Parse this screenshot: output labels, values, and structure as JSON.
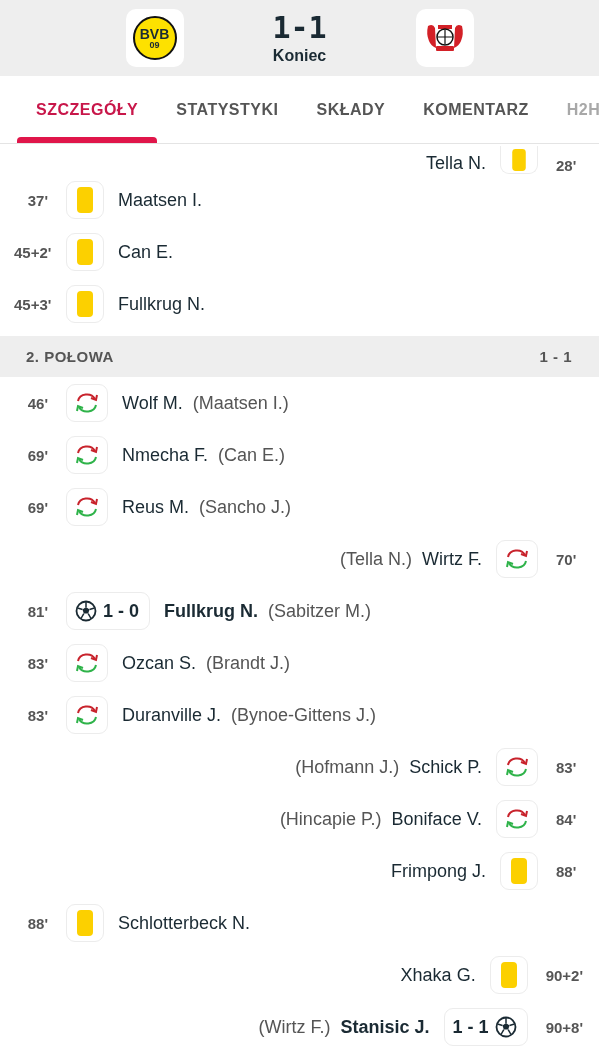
{
  "header": {
    "home_logo_lines": [
      "BVB",
      "09"
    ],
    "score": "1-1",
    "status": "Koniec"
  },
  "tabs": [
    {
      "label": "SZCZEGÓŁY",
      "selected": true
    },
    {
      "label": "STATYSTYKI",
      "selected": false
    },
    {
      "label": "SKŁADY",
      "selected": false
    },
    {
      "label": "KOMENTARZ",
      "selected": false
    },
    {
      "label": "H2H",
      "selected": false
    }
  ],
  "first_half_events": [
    {
      "away": {
        "kind": "yellow-card",
        "time": "28'",
        "player": "Tella N."
      }
    },
    {
      "home": {
        "kind": "yellow-card",
        "time": "37'",
        "player": "Maatsen I."
      }
    },
    {
      "home": {
        "kind": "yellow-card",
        "time": "45+2'",
        "player": "Can E."
      }
    },
    {
      "home": {
        "kind": "yellow-card",
        "time": "45+3'",
        "player": "Fullkrug N."
      }
    }
  ],
  "second_half": {
    "title": "2. POŁOWA",
    "score": "1 - 1"
  },
  "second_half_events": [
    {
      "home": {
        "kind": "substitution",
        "time": "46'",
        "player": "Wolf M.",
        "detail": "(Maatsen I.)"
      }
    },
    {
      "home": {
        "kind": "substitution",
        "time": "69'",
        "player": "Nmecha F.",
        "detail": "(Can E.)"
      }
    },
    {
      "home": {
        "kind": "substitution",
        "time": "69'",
        "player": "Reus M.",
        "detail": "(Sancho J.)"
      }
    },
    {
      "away": {
        "kind": "substitution",
        "time": "70'",
        "player": "Wirtz F.",
        "detail": "(Tella N.)"
      }
    },
    {
      "home": {
        "kind": "goal",
        "time": "81'",
        "score": "1 - 0",
        "player": "Fullkrug N.",
        "detail": "(Sabitzer M.)"
      }
    },
    {
      "home": {
        "kind": "substitution",
        "time": "83'",
        "player": "Ozcan S.",
        "detail": "(Brandt J.)"
      }
    },
    {
      "home": {
        "kind": "substitution",
        "time": "83'",
        "player": "Duranville J.",
        "detail": "(Bynoe-Gittens J.)"
      }
    },
    {
      "away": {
        "kind": "substitution",
        "time": "83'",
        "player": "Schick P.",
        "detail": "(Hofmann J.)"
      }
    },
    {
      "away": {
        "kind": "substitution",
        "time": "84'",
        "player": "Boniface V.",
        "detail": "(Hincapie P.)"
      }
    },
    {
      "away": {
        "kind": "yellow-card",
        "time": "88'",
        "player": "Frimpong J."
      }
    },
    {
      "home": {
        "kind": "yellow-card",
        "time": "88'",
        "player": "Schlotterbeck N."
      }
    },
    {
      "away": {
        "kind": "yellow-card",
        "time": "90+2'",
        "player": "Xhaka G."
      }
    },
    {
      "away": {
        "kind": "goal",
        "time": "90+8'",
        "score": "1 - 1",
        "player": "Stanisic J.",
        "detail": "(Wirtz F.)"
      }
    }
  ]
}
